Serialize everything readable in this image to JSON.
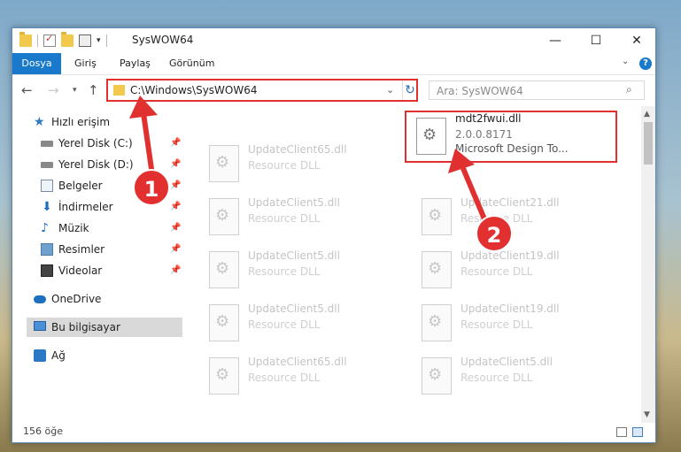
{
  "window": {
    "title": "SysWOW64"
  },
  "ribbon": {
    "tabs": [
      "Dosya",
      "Giriş",
      "Paylaş",
      "Görünüm"
    ]
  },
  "nav": {
    "address": "C:\\Windows\\SysWOW64",
    "search_placeholder": "Ara: SysWOW64"
  },
  "sidebar": {
    "items": [
      {
        "label": "Hızlı erişim",
        "icon": "star-icon"
      },
      {
        "label": "Yerel Disk (C:)",
        "icon": "drive-icon",
        "pinned": true
      },
      {
        "label": "Yerel Disk (D:)",
        "icon": "drive-icon",
        "pinned": true
      },
      {
        "label": "Belgeler",
        "icon": "documents-icon",
        "pinned": true
      },
      {
        "label": "İndirmeler",
        "icon": "downloads-icon",
        "pinned": true
      },
      {
        "label": "Müzik",
        "icon": "music-icon",
        "pinned": true
      },
      {
        "label": "Resimler",
        "icon": "pictures-icon",
        "pinned": true
      },
      {
        "label": "Videolar",
        "icon": "videos-icon",
        "pinned": true
      },
      {
        "label": "OneDrive",
        "icon": "onedrive-icon"
      },
      {
        "label": "Bu bilgisayar",
        "icon": "computer-icon",
        "selected": true
      },
      {
        "label": "Ağ",
        "icon": "network-icon"
      }
    ]
  },
  "files": {
    "left": [
      {
        "name": "UpdateClient65.dll",
        "desc": "Resource DLL"
      },
      {
        "name": "UpdateClient5.dll",
        "desc": "Resource DLL"
      },
      {
        "name": "UpdateClient5.dll",
        "desc": "Resource DLL"
      },
      {
        "name": "UpdateClient5.dll",
        "desc": "Resource DLL"
      },
      {
        "name": "UpdateClient65.dll",
        "desc": "Resource DLL"
      }
    ],
    "highlighted": {
      "name": "mdt2fwui.dll",
      "version": "2.0.0.8171",
      "desc": "Microsoft Design To..."
    },
    "right": [
      {
        "name": "UpdateClient21.dll",
        "desc": "Resource DLL"
      },
      {
        "name": "UpdateClient19.dll",
        "desc": "Resource DLL"
      },
      {
        "name": "UpdateClient19.dll",
        "desc": "Resource DLL"
      },
      {
        "name": "UpdateClient5.dll",
        "desc": "Resource DLL"
      }
    ]
  },
  "status": {
    "count": "156 öğe"
  },
  "annotations": {
    "step1": "1",
    "step2": "2",
    "color": "#e03030"
  }
}
